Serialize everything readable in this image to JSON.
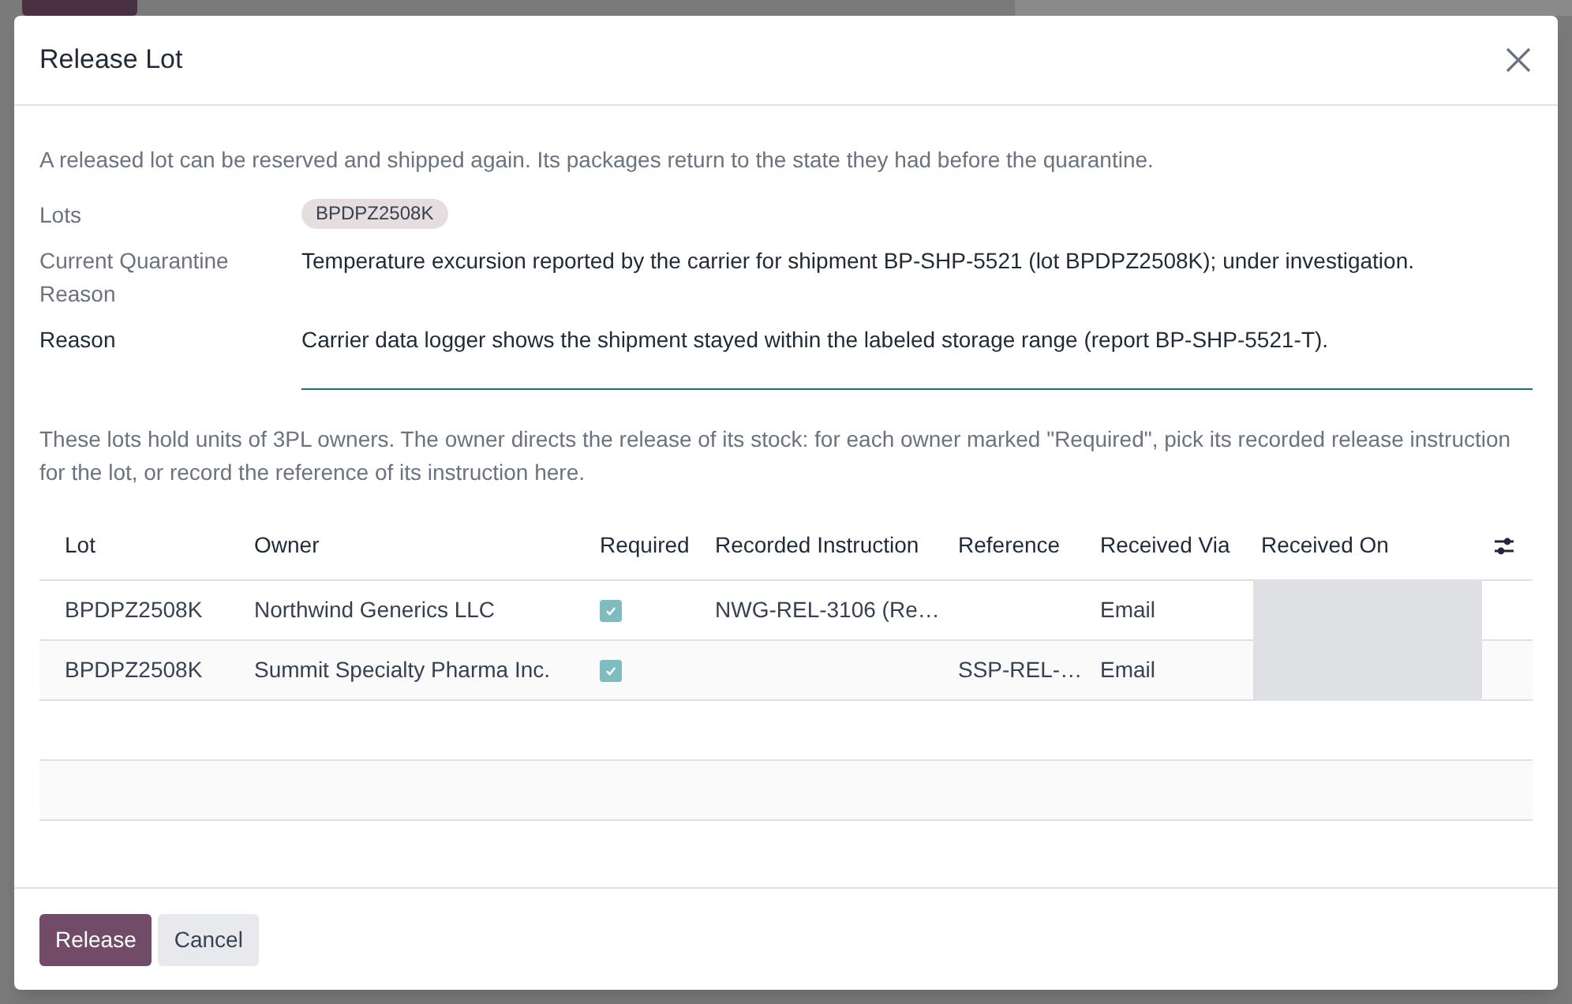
{
  "dialog": {
    "title": "Release Lot",
    "intro": "A released lot can be reserved and shipped again. Its packages return to the state they had before the quarantine.",
    "fields": [
      {
        "kind": "tags",
        "label": "Lots",
        "tags": [
          "BPDPZ2508K"
        ]
      },
      {
        "kind": "text",
        "label": "Current Quarantine Reason",
        "value": "Temperature excursion reported by the carrier for shipment BP-SHP-5521 (lot BPDPZ2508K); under investigation."
      },
      {
        "kind": "input",
        "label": "Reason",
        "value": "Carrier data logger shows the shipment stayed within the labeled storage range (report BP-SHP-5521-T)."
      }
    ],
    "owners_note": "These lots hold units of 3PL owners. The owner directs the release of its stock: for each owner marked \"Required\", pick its recorded release instruction for the lot, or record the reference of its instruction here.",
    "table": {
      "columns": [
        "Lot",
        "Owner",
        "Required",
        "Recorded Instruction",
        "Reference",
        "Received Via",
        "Received On"
      ],
      "rows": [
        {
          "lot": "BPDPZ2508K",
          "owner": "Northwind Generics LLC",
          "required": true,
          "recorded_instruction": "NWG-REL-3106 (Re…",
          "reference": "",
          "received_via": "Email"
        },
        {
          "lot": "BPDPZ2508K",
          "owner": "Summit Specialty Pharma Inc.",
          "required": true,
          "recorded_instruction": "",
          "reference": "SSP-REL-…",
          "received_via": "Email"
        }
      ]
    },
    "buttons": [
      {
        "kind": "primary",
        "label": "Release"
      },
      {
        "kind": "secondary",
        "label": "Cancel"
      }
    ]
  }
}
